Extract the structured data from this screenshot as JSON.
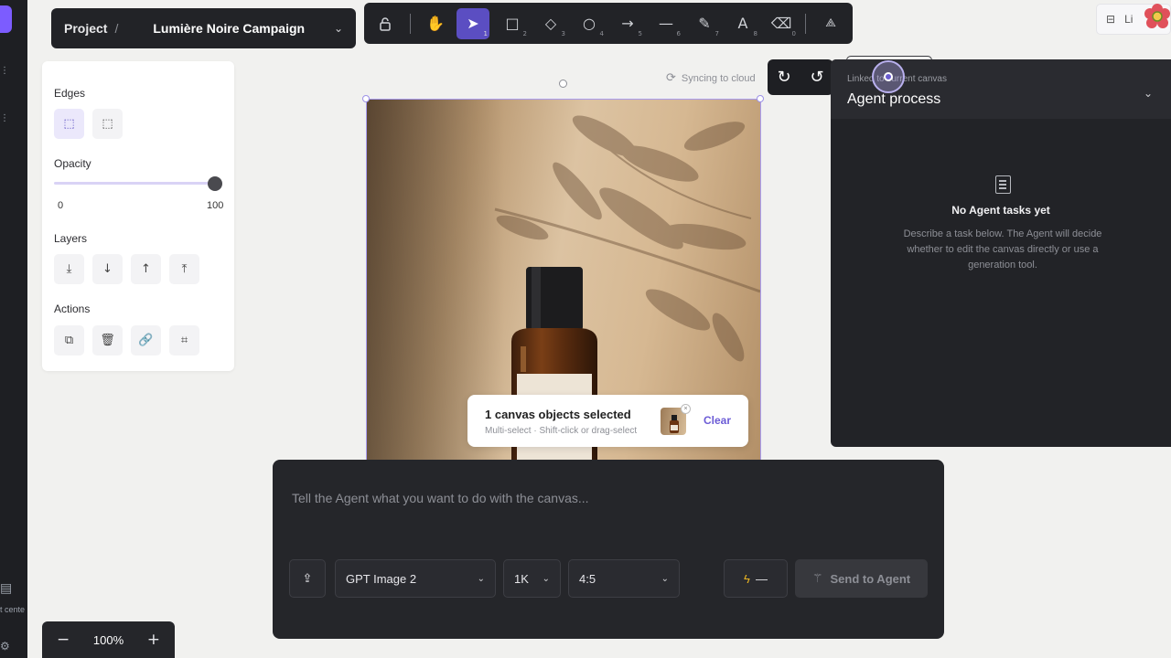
{
  "breadcrumb": {
    "project": "Project",
    "separator": "/",
    "name": "Lumière Noire Campaign"
  },
  "toolbar": {
    "tools": [
      {
        "name": "lock",
        "key": ""
      },
      {
        "name": "hand",
        "key": ""
      },
      {
        "name": "select",
        "key": "1"
      },
      {
        "name": "rectangle",
        "key": "2"
      },
      {
        "name": "diamond",
        "key": "3"
      },
      {
        "name": "ellipse",
        "key": "4"
      },
      {
        "name": "arrow",
        "key": "5"
      },
      {
        "name": "line",
        "key": "6"
      },
      {
        "name": "pencil",
        "key": "7"
      },
      {
        "name": "text",
        "key": "8"
      },
      {
        "name": "eraser",
        "key": "0"
      },
      {
        "name": "shapes",
        "key": ""
      }
    ],
    "active": "select"
  },
  "top_right": {
    "label": "Li"
  },
  "properties": {
    "edges_label": "Edges",
    "opacity_label": "Opacity",
    "opacity_value": 100,
    "opacity_min": "0",
    "opacity_max": "100",
    "layers_label": "Layers",
    "actions_label": "Actions"
  },
  "canvas": {
    "sync_status": "Syncing to cloud"
  },
  "selection_chip": {
    "title": "1 canvas objects selected",
    "hint": "Multi-select · Shift-click or drag-select",
    "clear_label": "Clear"
  },
  "agent_panel": {
    "linked_text": "Linked to current canvas",
    "title": "Agent process",
    "empty_title": "No Agent tasks yet",
    "empty_desc": "Describe a task below. The Agent will decide whether to edit the canvas directly or use a generation tool."
  },
  "composer": {
    "placeholder": "Tell the Agent what you want to do with the canvas...",
    "model": "GPT Image 2",
    "resolution": "1K",
    "aspect": "4:5",
    "credits": "—",
    "send_label": "Send to Agent"
  },
  "zoom": {
    "minus": "−",
    "value": "100%",
    "plus": "+"
  },
  "left_rail": {
    "footer_text": "t cente"
  },
  "colors": {
    "accent": "#5b4ec2",
    "panel_dark": "#222327",
    "canvas_bg": "#f1f1ef"
  }
}
